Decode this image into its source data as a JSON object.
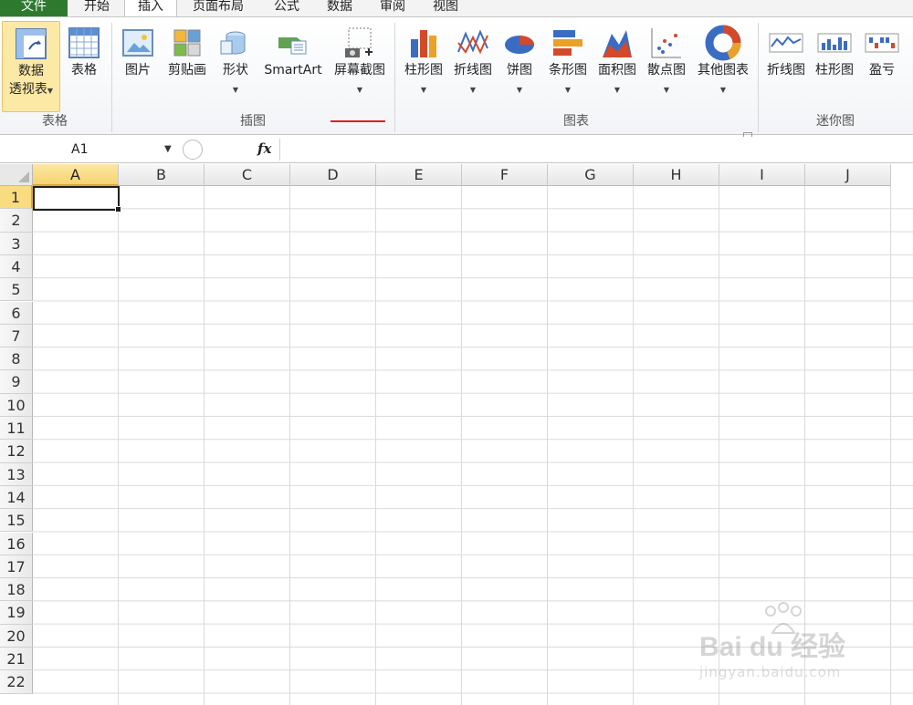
{
  "tabs": [
    {
      "label": "文件"
    },
    {
      "label": "开始"
    },
    {
      "label": "插入"
    },
    {
      "label": "页面布局"
    },
    {
      "label": "公式"
    },
    {
      "label": "数据"
    },
    {
      "label": "审阅"
    },
    {
      "label": "视图"
    }
  ],
  "ribbon": {
    "groups": {
      "table": "表格",
      "illustrations": "插图",
      "charts": "图表",
      "sparklines": "迷你图"
    },
    "pivot": {
      "line1": "数据",
      "line2": "透视表"
    },
    "table": "表格",
    "picture": "图片",
    "clipart": "剪贴画",
    "shapes": "形状",
    "smartart": "SmartArt",
    "screenshot": "屏幕截图",
    "column": "柱形图",
    "line": "折线图",
    "pie": "饼图",
    "bar": "条形图",
    "area": "面积图",
    "scatter": "散点图",
    "other": "其他图表",
    "spark_line": "折线图",
    "spark_column": "柱形图",
    "spark_winloss": "盈亏"
  },
  "formula_bar": {
    "name_box": "A1",
    "fx": "fx",
    "value": ""
  },
  "grid": {
    "columns": [
      "A",
      "B",
      "C",
      "D",
      "E",
      "F",
      "G",
      "H",
      "I",
      "J"
    ],
    "rows": [
      "1",
      "2",
      "3",
      "4",
      "5",
      "6",
      "7",
      "8",
      "9",
      "10",
      "11",
      "12",
      "13",
      "14",
      "15",
      "16",
      "17",
      "18",
      "19",
      "20",
      "21",
      "22"
    ],
    "active_cell": "A1"
  },
  "watermark": {
    "brand": "Bai du 经验",
    "url": "jingyan.baidu.com"
  }
}
